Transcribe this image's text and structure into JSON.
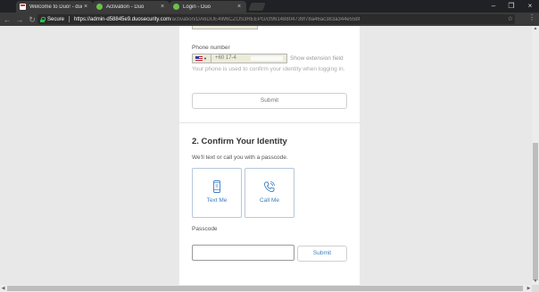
{
  "browser": {
    "tabs": [
      {
        "title": "Welcome to Duo! - duo",
        "favicon": "gmail-icon"
      },
      {
        "title": "Activation - Duo",
        "favicon": "duo-icon"
      },
      {
        "title": "Login - Duo",
        "favicon": "duo-icon"
      }
    ],
    "address": {
      "secure_label": "Secure",
      "host": "https://admin-d58845e9.duosecurity.com",
      "path": "/activation/DA6DUE4W6CZOS3REEPG/cf96148804739f78a46ac383a344e55bf"
    }
  },
  "page": {
    "phone_section": {
      "prev_field_value": "••••••••••••",
      "phone_label": "Phone number",
      "phone_value": "+60 17-4",
      "extension_link": "Show extension field",
      "help_text": "Your phone is used to confirm your identity when logging in.",
      "submit_label": "Submit"
    },
    "confirm_section": {
      "heading": "2. Confirm Your Identity",
      "subtext": "We'll text or call you with a passcode.",
      "methods": [
        {
          "label": "Text Me",
          "icon": "phone-icon"
        },
        {
          "label": "Call Me",
          "icon": "phone-call-icon"
        }
      ],
      "passcode_label": "Passcode",
      "passcode_value": "",
      "submit_label": "Submit"
    }
  },
  "colors": {
    "link_blue": "#3b7fc4",
    "method_border": "#b7c8dc",
    "secure_green": "#27c24c",
    "page_bg": "#e8e8e8"
  }
}
